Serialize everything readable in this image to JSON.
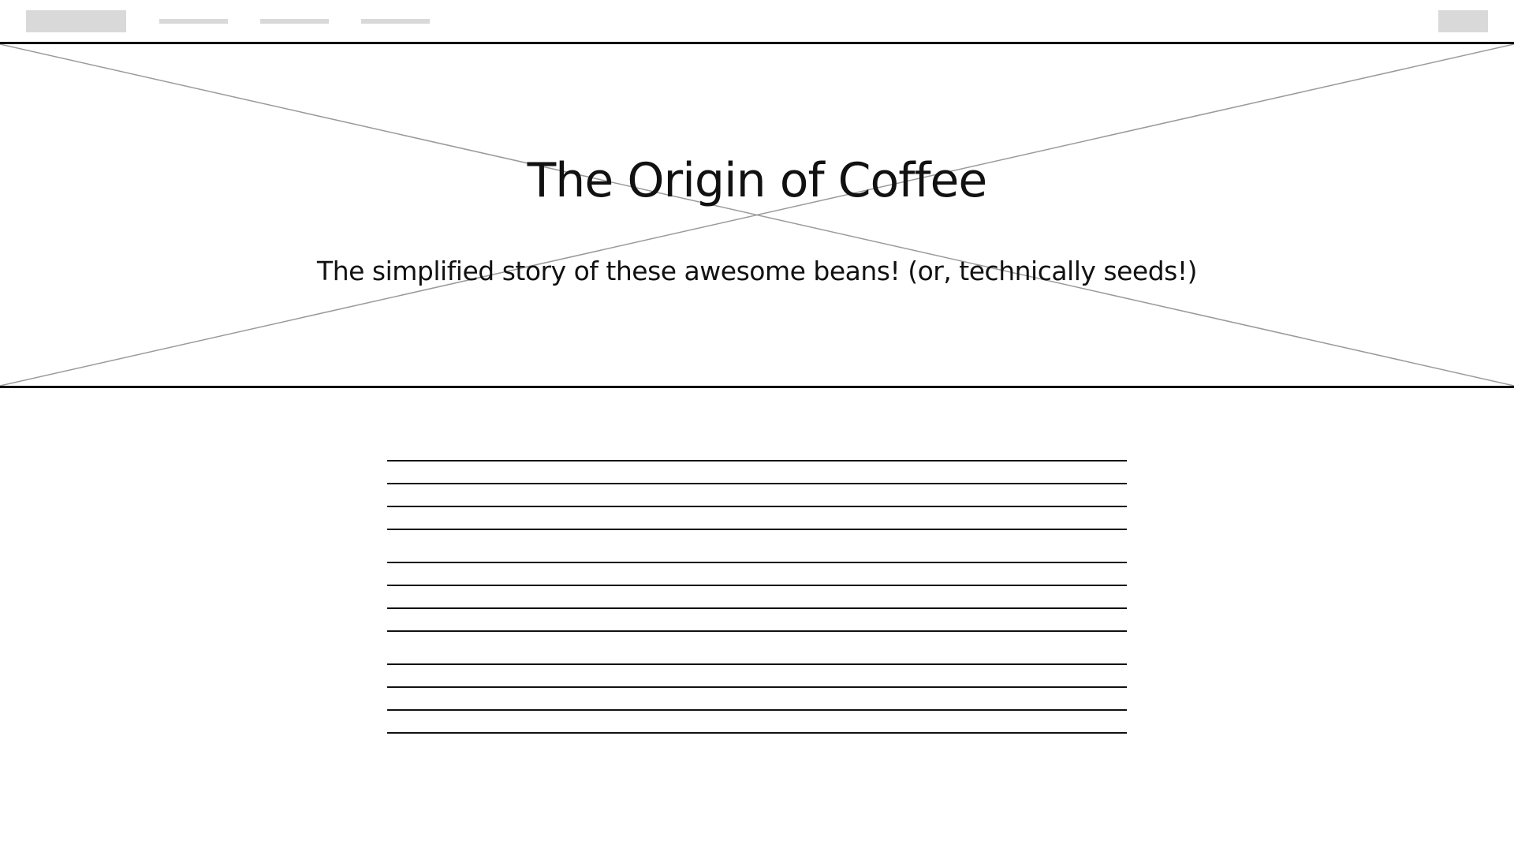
{
  "hero": {
    "title": "The Origin of Coffee",
    "subtitle": "The simplified story of these awesome beans! (or, technically seeds!)"
  },
  "colors": {
    "placeholder_gray": "#d9d9d9",
    "line_dark": "#111111",
    "cross_gray": "#9a9a9a",
    "background": "#ffffff"
  },
  "icons": {
    "hero_image": "image-placeholder-cross"
  }
}
